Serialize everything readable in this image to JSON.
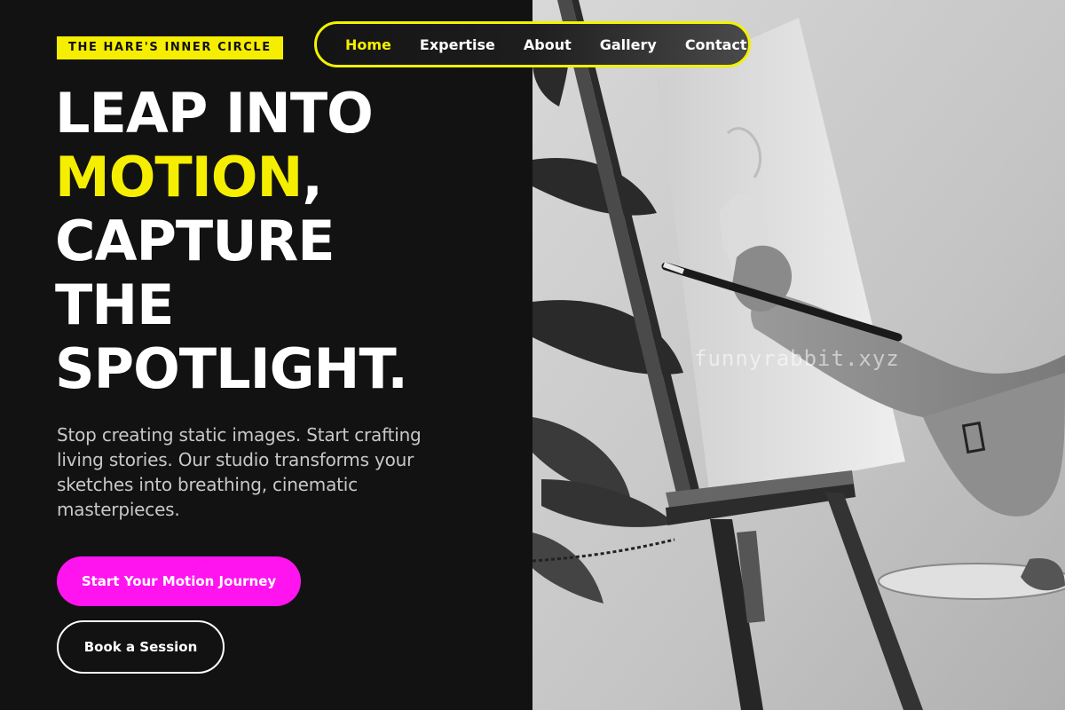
{
  "brand": {
    "badge": "THE HARE'S INNER CIRCLE"
  },
  "nav": {
    "items": [
      {
        "label": "Home",
        "active": true
      },
      {
        "label": "Expertise",
        "active": false
      },
      {
        "label": "About",
        "active": false
      },
      {
        "label": "Gallery",
        "active": false
      },
      {
        "label": "Contact",
        "active": false
      }
    ]
  },
  "hero": {
    "line1": "LEAP INTO",
    "line2_highlight": "MOTION",
    "line2_rest": ",",
    "line3": "CAPTURE",
    "line4": "THE",
    "line5": "SPOTLIGHT.",
    "description": "Stop creating static images. Start crafting living stories. Our studio transforms your sketches into breathing, cinematic masterpieces.",
    "primary_cta": "Start Your Motion Journey",
    "secondary_cta": "Book a Session"
  },
  "image": {
    "watermark": "funnyrabbit.xyz",
    "subject": "painter-at-easel-photo"
  },
  "colors": {
    "background": "#121212",
    "accent_yellow": "#f5ee00",
    "accent_magenta": "#ff14f0",
    "text_muted": "#c8c8c8"
  }
}
